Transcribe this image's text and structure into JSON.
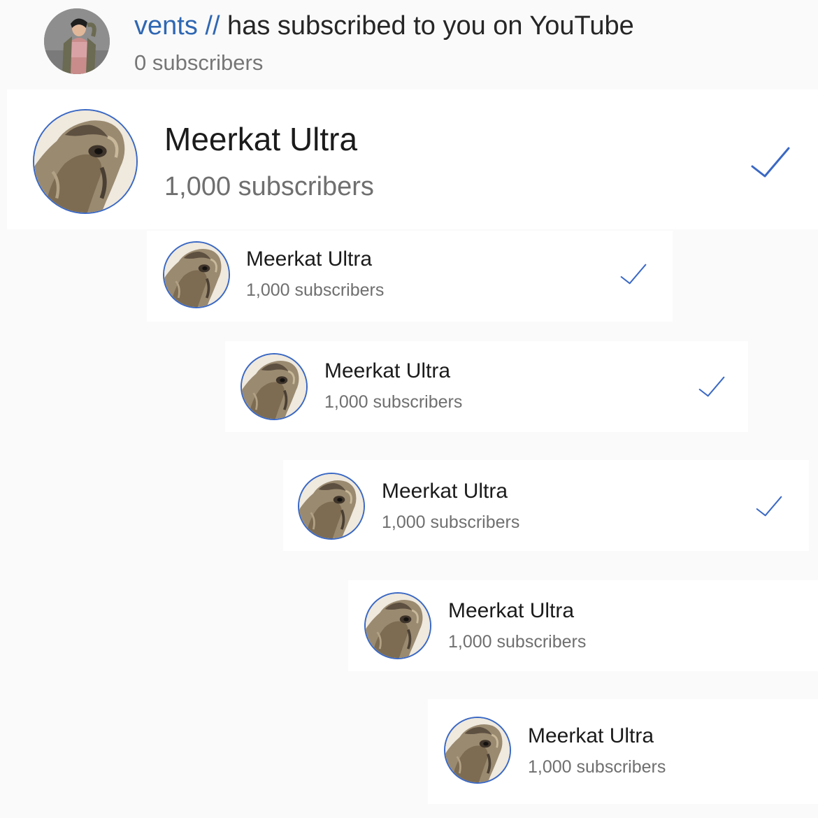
{
  "notification": {
    "username": "vents //",
    "message": " has subscribed to you on YouTube",
    "subscriber_count": "0 subscribers"
  },
  "channels": [
    {
      "name": "Meerkat Ultra",
      "subscribers": "1,000 subscribers",
      "subscribed": true
    },
    {
      "name": "Meerkat Ultra",
      "subscribers": "1,000 subscribers",
      "subscribed": true
    },
    {
      "name": "Meerkat Ultra",
      "subscribers": "1,000 subscribers",
      "subscribed": true
    },
    {
      "name": "Meerkat Ultra",
      "subscribers": "1,000 subscribers",
      "subscribed": true
    },
    {
      "name": "Meerkat Ultra",
      "subscribers": "1,000 subscribers",
      "subscribed": false
    },
    {
      "name": "Meerkat Ultra",
      "subscribers": "1,000 subscribers",
      "subscribed": false
    }
  ],
  "colors": {
    "accent": "#3a68c4",
    "username": "#2f67b2"
  },
  "icons": {
    "check": "checkmark-icon"
  }
}
